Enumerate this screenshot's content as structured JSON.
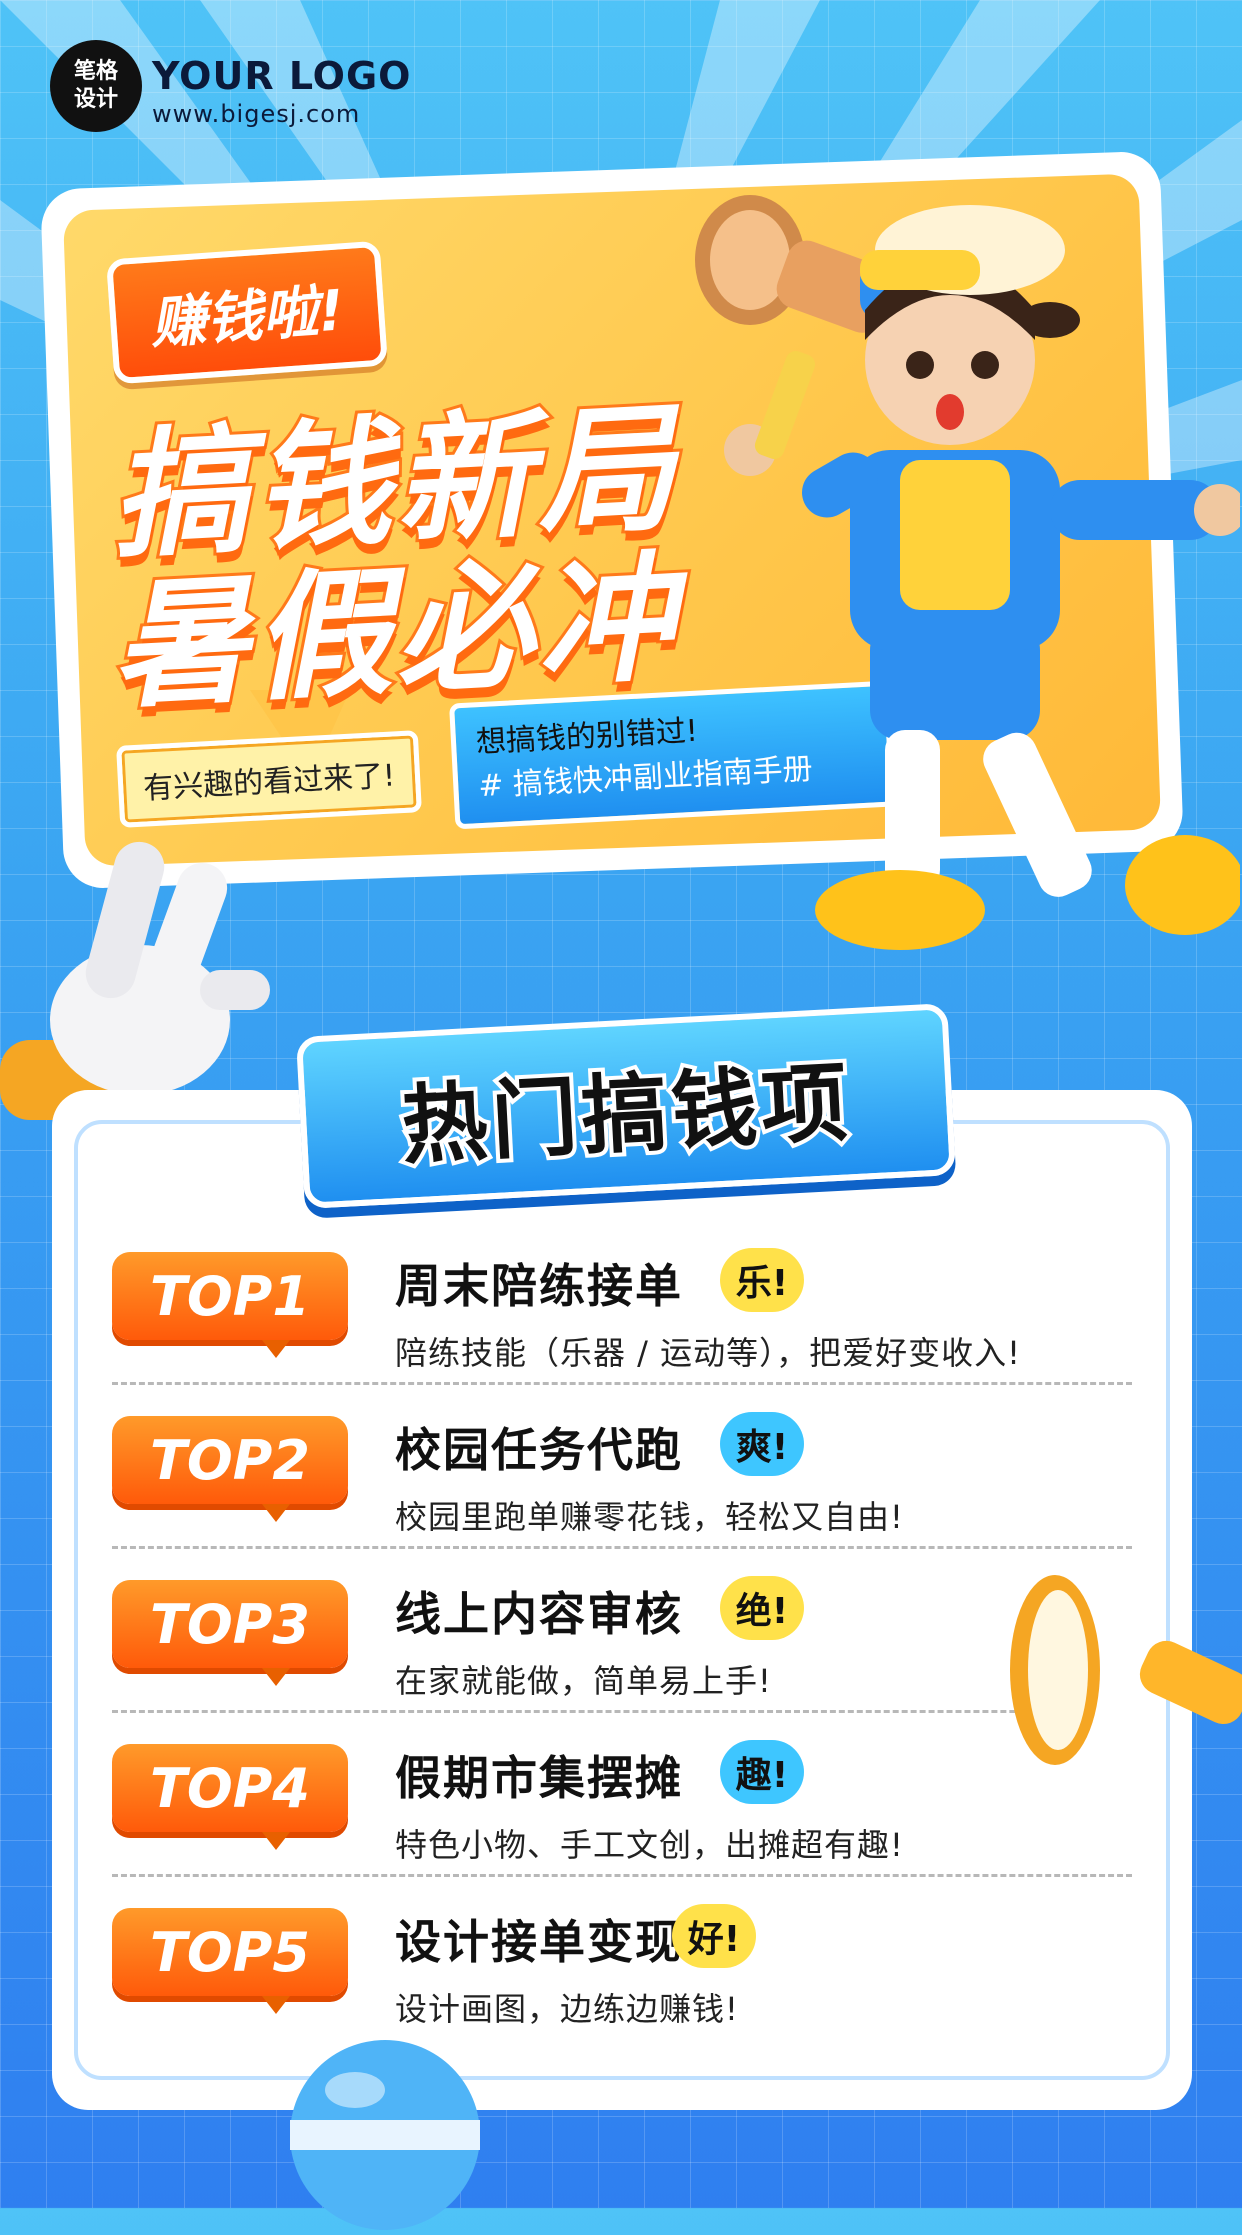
{
  "logo": {
    "badge_text": "笔格\n设计",
    "name": "YOUR LOGO",
    "url": "www.bigesj.com"
  },
  "hero": {
    "bubble": "赚钱啦!",
    "headline_line1": "搞钱新局",
    "headline_line2": "暑假必冲",
    "tag_left": "有兴趣的看过来了!",
    "tag_right_line1": "想搞钱的别错过!",
    "tag_right_line2": "# 搞钱快冲副业指南手册"
  },
  "list": {
    "title": "热门搞钱项",
    "items": [
      {
        "badge": "TOP1",
        "title": "周末陪练接单",
        "chip": "乐!",
        "chip_color": "yellow",
        "desc": "陪练技能（乐器 / 运动等），把爱好变收入!"
      },
      {
        "badge": "TOP2",
        "title": "校园任务代跑",
        "chip": "爽!",
        "chip_color": "blue",
        "desc": "校园里跑单赚零花钱，轻松又自由!"
      },
      {
        "badge": "TOP3",
        "title": "线上内容审核",
        "chip": "绝!",
        "chip_color": "yellow",
        "desc": "在家就能做，简单易上手!"
      },
      {
        "badge": "TOP4",
        "title": "假期市集摆摊",
        "chip": "趣!",
        "chip_color": "blue",
        "desc": "特色小物、手工文创，出摊超有趣!"
      },
      {
        "badge": "TOP5",
        "title": "设计接单变现",
        "chip": "好!",
        "chip_color": "yellow",
        "desc": "设计画图，边练边赚钱!"
      }
    ]
  },
  "colors": {
    "background": "#3aa4f2",
    "accent_orange": "#ff6a10",
    "hero_yellow": "#ffc64a",
    "badge_blue": "#1f8ff0"
  },
  "icons": [
    "girl-with-megaphone-illustration",
    "pointing-hand-icon",
    "megaphone-icon",
    "sphere-decoration"
  ]
}
